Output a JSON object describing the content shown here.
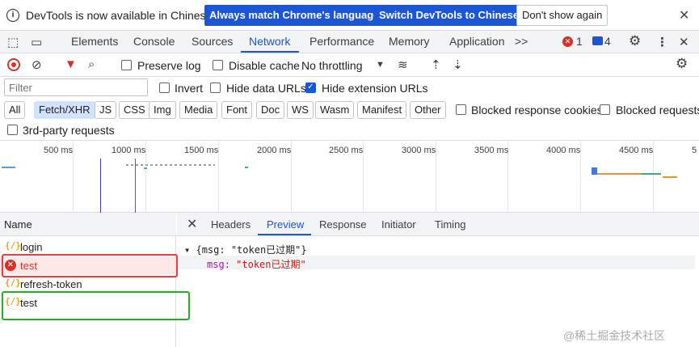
{
  "banner": {
    "message": "DevTools is now available in Chinese!",
    "btn_match": "Always match Chrome's language",
    "btn_switch": "Switch DevTools to Chinese",
    "btn_dont_show": "Don't show again"
  },
  "main_tabs": {
    "items": [
      "Elements",
      "Console",
      "Sources",
      "Network",
      "Performance",
      "Memory",
      "Application"
    ],
    "active": "Network",
    "more": ">>",
    "error_count": "1",
    "message_count": "4"
  },
  "toolbar": {
    "preserve_log": "Preserve log",
    "disable_cache": "Disable cache",
    "throttling": "No throttling"
  },
  "filter": {
    "placeholder": "Filter",
    "invert": "Invert",
    "hide_data_urls": "Hide data URLs",
    "hide_extension_urls": "Hide extension URLs"
  },
  "type_filters": [
    "All",
    "Fetch/XHR",
    "JS",
    "CSS",
    "Img",
    "Media",
    "Font",
    "Doc",
    "WS",
    "Wasm",
    "Manifest",
    "Other"
  ],
  "type_filter_active": "Fetch/XHR",
  "blocked_response_cookies": "Blocked response cookies",
  "blocked_requests": "Blocked requests",
  "third_party": "3rd-party requests",
  "timeline": {
    "ticks": [
      "500 ms",
      "1000 ms",
      "1500 ms",
      "2000 ms",
      "2500 ms",
      "3000 ms",
      "3500 ms",
      "4000 ms",
      "4500 ms",
      "5"
    ]
  },
  "requests": {
    "header": "Name",
    "items": [
      {
        "name": "login",
        "status": "ok"
      },
      {
        "name": "test",
        "status": "failed"
      },
      {
        "name": "refresh-token",
        "status": "ok"
      },
      {
        "name": "test",
        "status": "ok"
      }
    ]
  },
  "details": {
    "tabs": [
      "Headers",
      "Preview",
      "Response",
      "Initiator",
      "Timing"
    ],
    "active": "Preview",
    "preview_summary": "{msg: \"token已过期\"}",
    "key": "msg",
    "value": "\"token已过期\""
  },
  "watermark": "@稀土掘金技术社区",
  "colors": {
    "accent": "#1a56d6",
    "error": "#d93025",
    "highlight_red": "#ee3a3a",
    "highlight_green": "#22b022"
  }
}
